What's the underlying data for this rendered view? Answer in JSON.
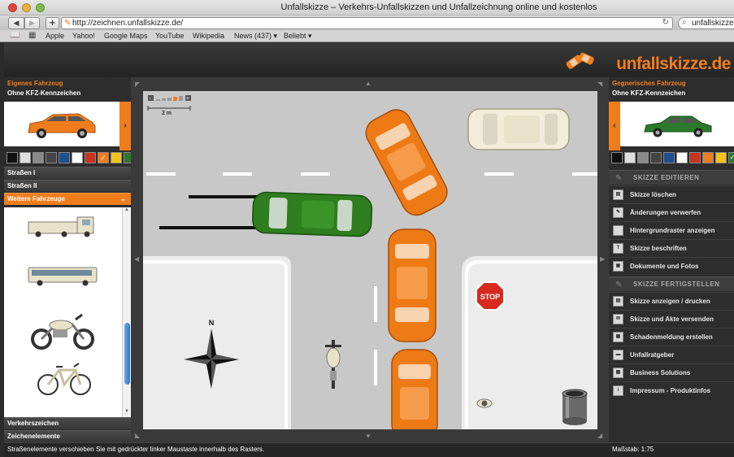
{
  "browser": {
    "window_title": "Unfallskizze – Verkehrs-Unfallskizzen und Unfallzeichnung online und kostenlos",
    "url": "http://zeichnen.unfallskizze.de/",
    "search_text": "unfallskizze",
    "bookmarks": [
      "Apple",
      "Yahoo!",
      "Google Maps",
      "YouTube",
      "Wikipedia",
      "News (437) ▾",
      "Beliebt ▾"
    ]
  },
  "app": {
    "logo": "unfallskizze.de",
    "brand_color": "#f07d1c"
  },
  "left_panel": {
    "title": "Eigenes Fahrzeug",
    "subtitle": "Ohne KFZ-Kennzeichen",
    "vehicle_color": "#f07d1c",
    "swatches": [
      "#111111",
      "#dddddd",
      "#8a8a8a",
      "#444444",
      "#1e4f8f",
      "#ffffff",
      "#c8321e",
      "#f07d1c",
      "#f2c319",
      "#2b7a2b"
    ],
    "selected_swatch": 7,
    "sections": {
      "strassen1": "Straßen I",
      "strassen2": "Straßen II",
      "weitere": "Weitere Fahrzeuge",
      "verkehrszeichen": "Verkehrszeichen",
      "zeichenelemente": "Zeichenelemente"
    },
    "vehicles": [
      "truck-icon",
      "bus-icon",
      "motorcycle-icon",
      "bicycle-icon"
    ]
  },
  "right_panel": {
    "title": "Gegnerisches Fahrzeug",
    "subtitle": "Ohne KFZ-Kennzeichen",
    "vehicle_color": "#2b7a2b",
    "swatches": [
      "#111111",
      "#dddddd",
      "#8a8a8a",
      "#444444",
      "#1e4f8f",
      "#ffffff",
      "#c8321e",
      "#f07d1c",
      "#f2c319",
      "#2b7a2b"
    ],
    "selected_swatch": 9,
    "edit_header": "SKIZZE EDITIEREN",
    "edit_items": [
      {
        "label": "Skizze löschen",
        "icon": "trash-icon"
      },
      {
        "label": "Änderungen verwerfen",
        "icon": "undo-icon"
      },
      {
        "label": "Hintergrundraster anzeigen",
        "icon": "grid-icon"
      },
      {
        "label": "Skizze beschriften",
        "icon": "text-icon"
      },
      {
        "label": "Dokumente und Fotos",
        "icon": "documents-icon"
      }
    ],
    "finish_header": "SKIZZE FERTIGSTELLEN",
    "finish_items": [
      {
        "label": "Skizze anzeigen / drucken",
        "icon": "print-icon"
      },
      {
        "label": "Skizze und Akte versenden",
        "icon": "mail-icon"
      },
      {
        "label": "Schadenmeldung erstellen",
        "icon": "report-icon"
      },
      {
        "label": "Unfallratgeber",
        "icon": "guide-icon"
      },
      {
        "label": "Business Solutions",
        "icon": "business-icon"
      },
      {
        "label": "Impressum - Produktinfos",
        "icon": "info-icon"
      }
    ]
  },
  "canvas": {
    "scale_label": "2 m",
    "stop_sign": "STOP",
    "compass_label": "N"
  },
  "status": {
    "hint": "Straßenelemente verschieben Sie mit gedrückter linker Maustaste innerhalb des Rasters.",
    "scale": "Maßstab: 1:75"
  }
}
